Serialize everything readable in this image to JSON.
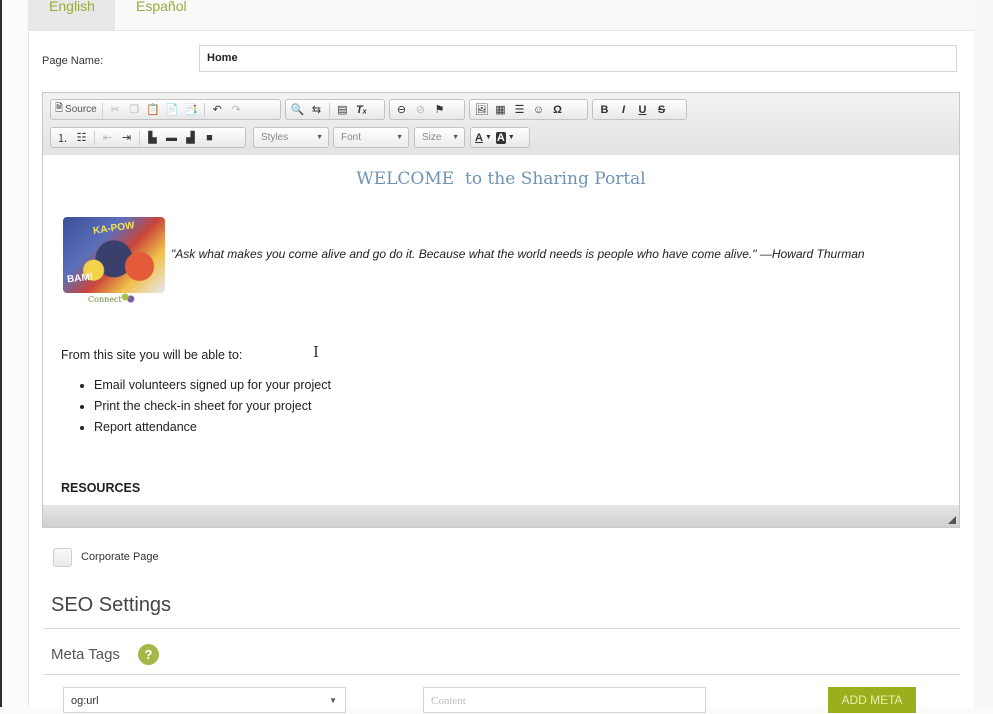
{
  "tabs": [
    {
      "label": "English",
      "active": true
    },
    {
      "label": "Español",
      "active": false
    }
  ],
  "page_name": {
    "label": "Page Name:",
    "value": "Home"
  },
  "toolbar": {
    "source_label": "Source",
    "styles_label": "Styles",
    "font_label": "Font",
    "size_label": "Size",
    "bold_label": "B",
    "italic_label": "I",
    "underline_label": "U",
    "strike_label": "S",
    "omega_label": "Ω",
    "text_color_label": "A",
    "bg_color_label": "A"
  },
  "content": {
    "heading": "WELCOME  to the Sharing Portal",
    "image_text_1": "KA-POW",
    "image_text_2": "BAM!",
    "logo_text": "Connect",
    "quote": "\"Ask what makes you come alive and go do it. Because what the world needs is people who have come alive.\" —Howard Thurman",
    "intro": "From this site you will be able to:",
    "bullets": [
      "Email volunteers signed up for your project",
      "Print the check-in sheet for your project",
      "Report attendance"
    ],
    "resources_heading": "RESOURCES"
  },
  "corporate_page": {
    "label": "Corporate Page",
    "checked": false
  },
  "seo": {
    "title": "SEO Settings",
    "meta_tags_label": "Meta Tags",
    "help_glyph": "?",
    "meta_select_value": "og:url",
    "content_placeholder": "Content",
    "add_meta_label": "ADD META"
  },
  "colors": {
    "accent": "#9cad1e",
    "tab_text": "#9aaa3a",
    "heading": "#6f93b4",
    "help_badge": "#a4b84a"
  }
}
